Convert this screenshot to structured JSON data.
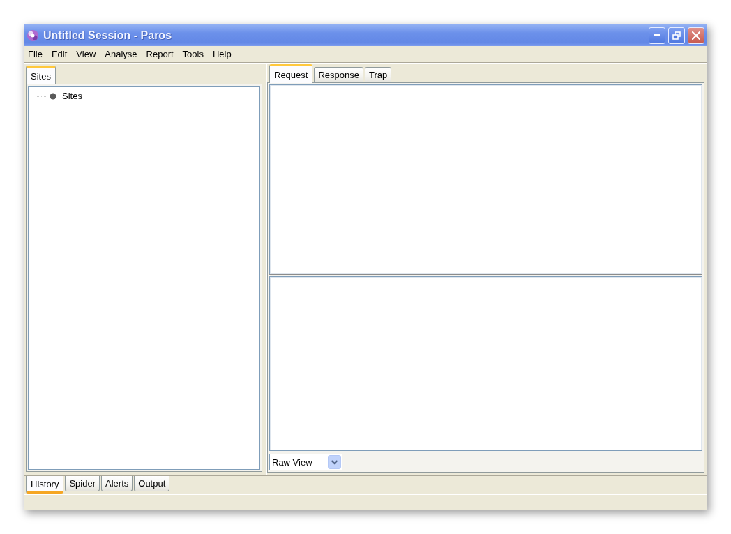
{
  "window": {
    "title": "Untitled Session - Paros"
  },
  "menu_bar": {
    "items": [
      "File",
      "Edit",
      "View",
      "Analyse",
      "Report",
      "Tools",
      "Help"
    ]
  },
  "sites_panel": {
    "tabs": [
      {
        "label": "Sites",
        "selected": true
      }
    ],
    "tree": [
      {
        "label": "Sites"
      }
    ]
  },
  "message_panel": {
    "tabs": [
      {
        "label": "Request",
        "selected": true
      },
      {
        "label": "Response",
        "selected": false
      },
      {
        "label": "Trap",
        "selected": false
      }
    ],
    "view_dropdown": {
      "value": "Raw View"
    }
  },
  "bottom_panel": {
    "tabs": [
      {
        "label": "History",
        "selected": true
      },
      {
        "label": "Spider",
        "selected": false
      },
      {
        "label": "Alerts",
        "selected": false
      },
      {
        "label": "Output",
        "selected": false
      }
    ]
  }
}
